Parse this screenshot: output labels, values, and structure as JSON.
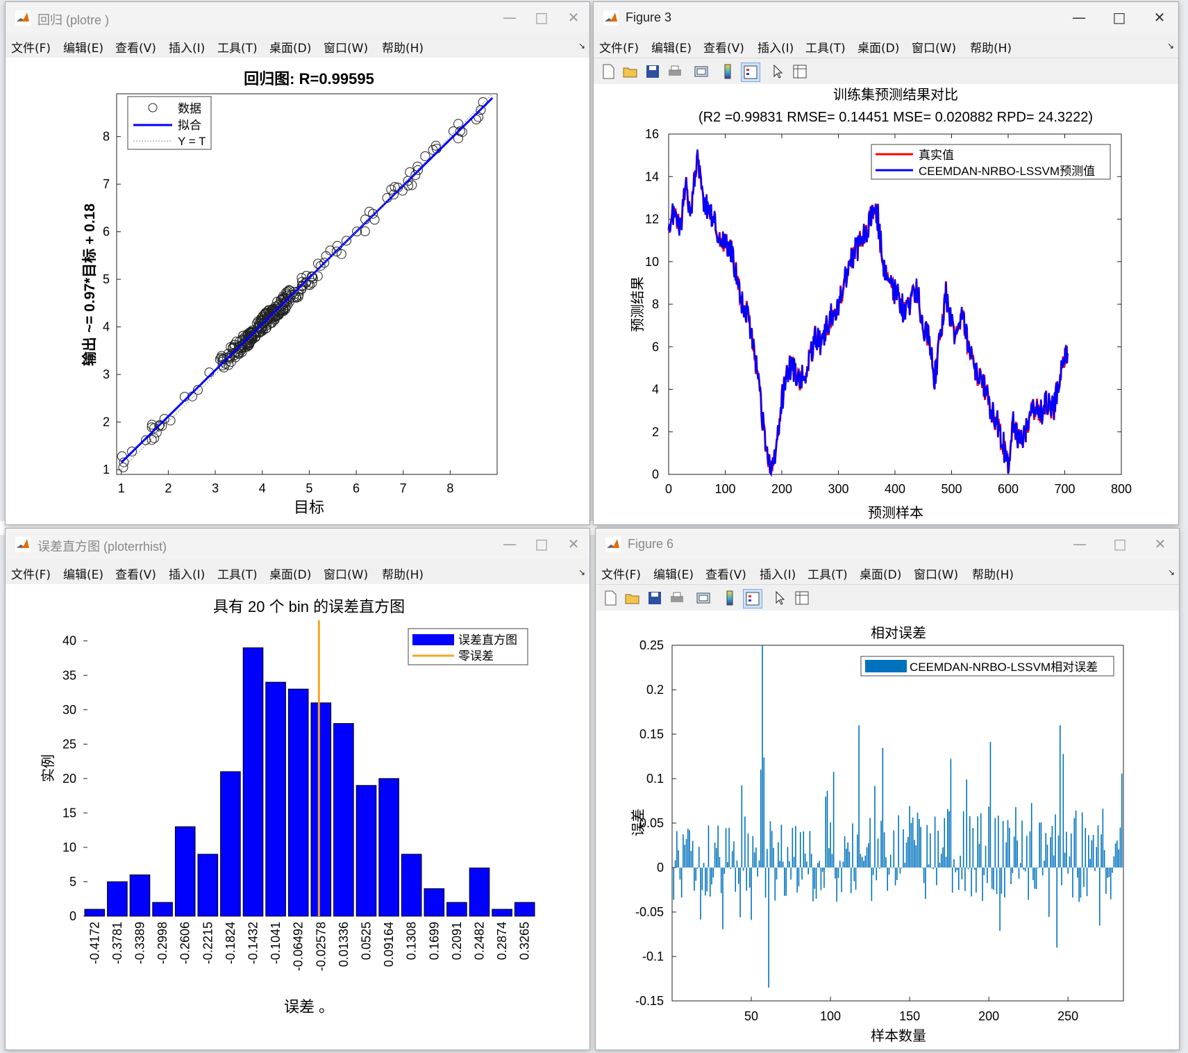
{
  "windows": {
    "regression": {
      "title": "回归 (plotre          )",
      "menu": [
        "文件(F)",
        "编辑(E)",
        "查看(V)",
        "插入(I)",
        "工具(T)",
        "桌面(D)",
        "窗口(W)",
        "帮助(H)"
      ],
      "plot_title": "回归图: R=0.99595",
      "xlabel": "目标",
      "ylabel": "输出 ~= 0.97*目标 + 0.18",
      "legend": [
        "数据",
        "拟合",
        "Y = T"
      ],
      "xticks": [
        "1",
        "2",
        "3",
        "4",
        "5",
        "6",
        "7",
        "8"
      ],
      "yticks": [
        "1",
        "2",
        "3",
        "4",
        "5",
        "6",
        "7",
        "8"
      ]
    },
    "figure3": {
      "title": "Figure 3",
      "menu": [
        "文件(F)",
        "编辑(E)",
        "查看(V)",
        "插入(I)",
        "工具(T)",
        "桌面(D)",
        "窗口(W)",
        "帮助(H)"
      ],
      "plot_title": "训练集预测结果对比",
      "plot_subtitle": "(R2 =0.99831 RMSE= 0.14451 MSE= 0.020882 RPD= 24.3222)",
      "xlabel": "预测样本",
      "ylabel": "预测结果",
      "legend": [
        "真实值",
        "CEEMDAN-NRBO-LSSVM预测值"
      ],
      "xticks": [
        "0",
        "100",
        "200",
        "300",
        "400",
        "500",
        "600",
        "700",
        "800"
      ],
      "yticks": [
        "0",
        "2",
        "4",
        "6",
        "8",
        "10",
        "12",
        "14",
        "16"
      ]
    },
    "errhist": {
      "title": "误差直方图 (ploterrhist)",
      "menu": [
        "文件(F)",
        "编辑(E)",
        "查看(V)",
        "插入(I)",
        "工具(T)",
        "桌面(D)",
        "窗口(W)",
        "帮助(H)"
      ],
      "plot_title": "具有 20 个 bin 的误差直方图",
      "xlabel": "误差 。",
      "ylabel": "实例",
      "legend": [
        "误差直方图",
        "零误差"
      ],
      "yticks": [
        "0",
        "5",
        "10",
        "15",
        "20",
        "25",
        "30",
        "35",
        "40"
      ]
    },
    "figure6": {
      "title": "Figure 6",
      "menu": [
        "文件(F)",
        "编辑(E)",
        "查看(V)",
        "插入(I)",
        "工具(T)",
        "桌面(D)",
        "窗口(W)",
        "帮助(H)"
      ],
      "plot_title": "相对误差",
      "xlabel": "样本数量",
      "ylabel": "误差",
      "legend": [
        "CEEMDAN-NRBO-LSSVM相对误差"
      ],
      "xticks": [
        "50",
        "100",
        "150",
        "200",
        "250"
      ],
      "yticks": [
        "0.25",
        "0.2",
        "0.15",
        "0.1",
        "0.05",
        "0",
        "-0.05",
        "-0.1",
        "-0.15"
      ]
    }
  },
  "colors": {
    "accent_blue": "#0000ff",
    "red": "#ff0000",
    "orange": "#f5a623",
    "bar_blue": "#0072bd"
  },
  "chart_data": [
    {
      "type": "scatter",
      "title": "回归图: R=0.99595",
      "xlabel": "目标",
      "ylabel": "输出 ~= 0.97*目标 + 0.18",
      "xlim": [
        0.9,
        9.0
      ],
      "ylim": [
        0.9,
        8.9
      ],
      "fit": {
        "slope": 0.97,
        "intercept": 0.18
      },
      "series": [
        {
          "name": "数据",
          "count": 300
        }
      ],
      "grid": false,
      "legend": "top-left"
    },
    {
      "type": "line",
      "title": "训练集预测结果对比",
      "xlabel": "预测样本",
      "ylabel": "预测结果",
      "xlim": [
        0,
        800
      ],
      "ylim": [
        0,
        16
      ],
      "series": [
        {
          "name": "真实值",
          "color": "#ff0000"
        },
        {
          "name": "CEEMDAN-NRBO-LSSVM预测值",
          "color": "#0000ff"
        }
      ],
      "x": [
        0,
        10,
        20,
        30,
        40,
        50,
        60,
        70,
        80,
        90,
        100,
        110,
        120,
        130,
        140,
        150,
        160,
        170,
        180,
        190,
        200,
        210,
        220,
        230,
        240,
        250,
        260,
        270,
        280,
        290,
        300,
        310,
        320,
        330,
        340,
        350,
        360,
        370,
        380,
        390,
        400,
        410,
        420,
        430,
        440,
        450,
        460,
        470,
        480,
        490,
        500,
        510,
        520,
        530,
        540,
        550,
        560,
        570,
        580,
        590,
        600,
        610,
        620,
        630,
        640,
        650,
        660,
        670,
        680,
        690,
        700,
        705
      ],
      "values": [
        11,
        12.5,
        11.5,
        13.5,
        12.5,
        15,
        13,
        12.5,
        12,
        11,
        11,
        10.5,
        9.5,
        8,
        7.5,
        6,
        4,
        1.5,
        0.2,
        1,
        3.5,
        5,
        5,
        4.5,
        4.5,
        5.5,
        6.5,
        6,
        7,
        7.5,
        8,
        9,
        10,
        10.5,
        11,
        11.5,
        12.5,
        12,
        9.5,
        9,
        8.5,
        8,
        7.5,
        8.5,
        8.5,
        7,
        6.5,
        4.5,
        6.5,
        8.5,
        7,
        6.5,
        7.5,
        6,
        5,
        4.5,
        4,
        3,
        2.5,
        1.5,
        0.5,
        2.5,
        1.5,
        2,
        3,
        3,
        3,
        3.5,
        3,
        4.5,
        5.5,
        5.7
      ],
      "legend": "top-right"
    },
    {
      "type": "bar",
      "title": "具有 20 个 bin 的误差直方图",
      "xlabel": "误差 。",
      "ylabel": "实例",
      "categories": [
        "-0.4172",
        "-0.3781",
        "-0.3389",
        "-0.2998",
        "-0.2606",
        "-0.2215",
        "-0.1824",
        "-0.1432",
        "-0.1041",
        "-0.06492",
        "-0.02578",
        "0.01336",
        "0.0525",
        "0.09164",
        "0.1308",
        "0.1699",
        "0.2091",
        "0.2482",
        "0.2874",
        "0.3265"
      ],
      "values": [
        1,
        5,
        6,
        2,
        13,
        9,
        21,
        39,
        34,
        33,
        31,
        28,
        19,
        20,
        9,
        4,
        2,
        7,
        1,
        2
      ],
      "ylim": [
        0,
        43
      ],
      "zero_error_bin_index": 10.5,
      "legend": "top-right"
    },
    {
      "type": "bar",
      "title": "相对误差",
      "xlabel": "样本数量",
      "ylabel": "误差",
      "xlim": [
        0,
        285
      ],
      "ylim": [
        -0.15,
        0.25
      ],
      "series": [
        {
          "name": "CEEMDAN-NRBO-LSSVM相对误差",
          "count": 284
        }
      ],
      "legend": "top-right"
    }
  ]
}
